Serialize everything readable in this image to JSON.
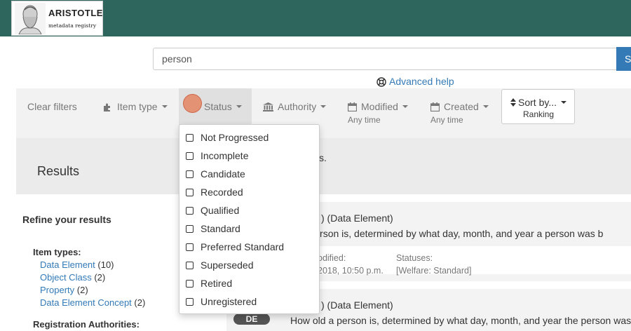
{
  "header": {
    "logo_title": "ARISTOTLE",
    "logo_subtitle": "metadata registry"
  },
  "search": {
    "query": "person",
    "button_label": "S",
    "advanced_help": "Advanced help"
  },
  "filters": {
    "clear": "Clear filters",
    "item_type": "Item type",
    "status": "Status",
    "authority": "Authority",
    "modified": "Modified",
    "modified_sub": "Any time",
    "created": "Created",
    "created_sub": "Any time",
    "sort_label": "Sort by...",
    "sort_value": "Ranking"
  },
  "status_options": [
    {
      "label": "Not Progressed",
      "checked": false
    },
    {
      "label": "Incomplete",
      "checked": false
    },
    {
      "label": "Candidate",
      "checked": false
    },
    {
      "label": "Recorded",
      "checked": false
    },
    {
      "label": "Qualified",
      "checked": false
    },
    {
      "label": "Standard",
      "checked": false
    },
    {
      "label": "Preferred Standard",
      "checked": false
    },
    {
      "label": "Superseded",
      "checked": false
    },
    {
      "label": "Retired",
      "checked": false
    },
    {
      "label": "Unregistered",
      "checked": false
    }
  ],
  "results": {
    "title": "Results",
    "tail_text": "s."
  },
  "sidebar": {
    "refine_title": "Refine your results",
    "item_types_title": "Item types:",
    "item_types": [
      {
        "label": "Data Element",
        "count": "(10)"
      },
      {
        "label": "Object Class",
        "count": "(2)"
      },
      {
        "label": "Property",
        "count": "(2)"
      },
      {
        "label": "Data Element Concept",
        "count": "(2)"
      }
    ],
    "reg_auth_title": "Registration Authorities:"
  },
  "cards": [
    {
      "title": ") (Data Element)",
      "description": "ld a person is, determined by what day, month, and year a person was b",
      "modified_label": "odified:",
      "modified_value": "2018, 10:50 p.m.",
      "statuses_label": "Statuses:",
      "statuses_value": "[Welfare: Standard]"
    },
    {
      "badge": "DE",
      "title": ") (Data Element)",
      "description": "How old a person is, determined by what day, month, and year the person was"
    }
  ],
  "colors": {
    "topbar": "#2e655d",
    "link": "#337ab7",
    "filterbar": "#f2f2f2",
    "active_filter": "#e0e0e0"
  }
}
